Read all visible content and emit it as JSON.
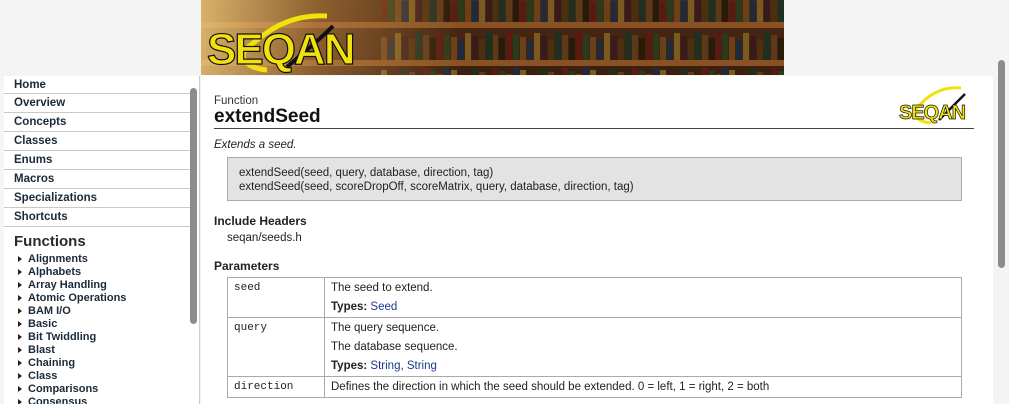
{
  "banner": {
    "logo_text": "SEQAN"
  },
  "sidebar": {
    "nav_items": [
      "Home",
      "Overview",
      "Concepts",
      "Classes",
      "Enums",
      "Macros",
      "Specializations",
      "Shortcuts"
    ],
    "section_title": "Functions",
    "function_groups": [
      "Alignments",
      "Alphabets",
      "Array Handling",
      "Atomic Operations",
      "BAM I/O",
      "Basic",
      "Bit Twiddling",
      "Blast",
      "Chaining",
      "Class",
      "Comparisons",
      "Consensus"
    ]
  },
  "content": {
    "kind": "Function",
    "title": "extendSeed",
    "logo_text": "SEQAN",
    "summary": "Extends a seed.",
    "signatures": [
      "extendSeed(seed, query, database, direction, tag)",
      "extendSeed(seed, scoreDropOff, scoreMatrix, query, database, direction, tag)"
    ],
    "include_headers_label": "Include Headers",
    "include_header": "seqan/seeds.h",
    "parameters_label": "Parameters",
    "types_label": "Types:",
    "parameters": [
      {
        "name": "seed",
        "desc": [
          "The seed to extend."
        ],
        "types": [
          "Seed"
        ]
      },
      {
        "name": "query",
        "desc": [
          "The query sequence.",
          "The database sequence."
        ],
        "types": [
          "String",
          "String"
        ]
      },
      {
        "name": "direction",
        "desc": [
          "Defines the direction in which the seed should be extended. 0 = left, 1 = right, 2 = both"
        ],
        "types": []
      }
    ]
  }
}
